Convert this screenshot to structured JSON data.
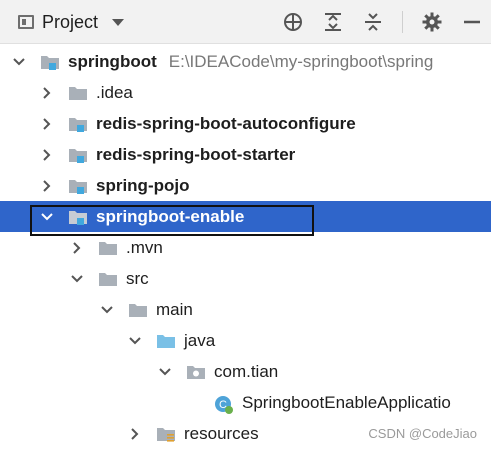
{
  "header": {
    "title": "Project",
    "icons": [
      "project-window-icon",
      "chevron-down-icon",
      "locate-icon",
      "expand-all-icon",
      "collapse-all-icon",
      "gear-icon",
      "minimize-icon"
    ]
  },
  "tree": {
    "root": {
      "label": "springboot",
      "path": "E:\\IDEACode\\my-springboot\\spring"
    },
    "items": [
      {
        "label": ".idea"
      },
      {
        "label": "redis-spring-boot-autoconfigure"
      },
      {
        "label": "redis-spring-boot-starter"
      },
      {
        "label": "spring-pojo"
      },
      {
        "label": "springboot-enable"
      },
      {
        "label": ".mvn"
      },
      {
        "label": "src"
      },
      {
        "label": "main"
      },
      {
        "label": "java"
      },
      {
        "label": "com.tian"
      },
      {
        "label": "SpringbootEnableApplicatio"
      },
      {
        "label": "resources"
      }
    ]
  },
  "colors": {
    "selection": "#2f65ca",
    "folder": "#a9b0b8",
    "source_folder": "#7ac0e6",
    "module_mark": "#40a8de"
  },
  "watermark": "CSDN @CodeJiao"
}
